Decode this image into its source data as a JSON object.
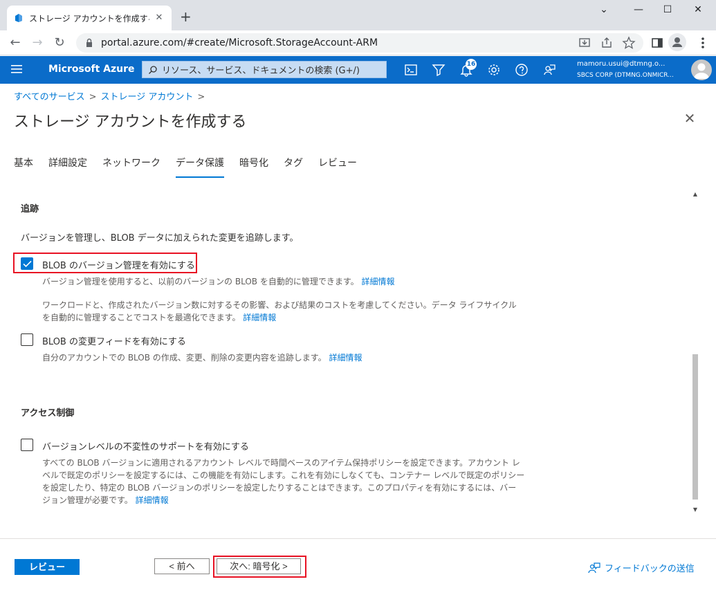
{
  "browser": {
    "tab_title": "ストレージ アカウントを作成する - Mic",
    "new_tab": "+",
    "url": "portal.azure.com/#create/Microsoft.StorageAccount-ARM",
    "min": "⌄",
    "minimize": "—",
    "maximize": "☐",
    "close": "✕"
  },
  "azure_bar": {
    "brand": "Microsoft Azure",
    "search_placeholder": "リソース、サービス、ドキュメントの検索 (G+/)",
    "notification_count": "16",
    "user_name": "mamoru.usui@dtmng.o...",
    "user_org": "SBCS CORP (DTMNG.ONMICR..."
  },
  "breadcrumb": {
    "item1": "すべてのサービス",
    "item2": "ストレージ アカウント",
    "sep": ">"
  },
  "page": {
    "title": "ストレージ アカウントを作成する",
    "more": "···",
    "close": "✕"
  },
  "tabs": [
    "基本",
    "詳細設定",
    "ネットワーク",
    "データ保護",
    "暗号化",
    "タグ",
    "レビュー"
  ],
  "tracking": {
    "title": "追跡",
    "desc": "バージョンを管理し、BLOB データに加えられた変更を追跡します。",
    "versioning_label": "BLOB のバージョン管理を有効にする",
    "versioning_desc": "バージョン管理を使用すると、以前のバージョンの BLOB を自動的に管理できます。",
    "versioning_link": "詳細情報",
    "workload_desc1": "ワークロードと、作成されたバージョン数に対するその影響、および結果のコストを考慮してください。データ ライフサイクル",
    "workload_desc2": "を自動的に管理することでコストを最適化できます。",
    "workload_link": "詳細情報",
    "changefeed_label": "BLOB の変更フィードを有効にする",
    "changefeed_desc": "自分のアカウントでの BLOB の作成、変更、削除の変更内容を追跡します。",
    "changefeed_link": "詳細情報"
  },
  "access": {
    "title": "アクセス制御",
    "immutability_label": "バージョンレベルの不変性のサポートを有効にする",
    "desc1": "すべての BLOB バージョンに適用されるアカウント レベルで時間ベースのアイテム保持ポリシーを設定できます。アカウント レ",
    "desc2": "ベルで既定のポリシーを設定するには、この機能を有効にします。これを有効にしなくても、コンテナー レベルで既定のポリシー",
    "desc3": "を設定したり、特定の BLOB バージョンのポリシーを設定したりすることはできます。このプロパティを有効にするには、バー",
    "desc4": "ジョン管理が必要です。",
    "link": "詳細情報"
  },
  "footer": {
    "review": "レビュー",
    "prev": "< 前へ",
    "next": "次へ: 暗号化 >",
    "feedback": "フィードバックの送信"
  },
  "colors": {
    "azure_blue": "#0b6cc9",
    "link": "#0078d4",
    "highlight": "#e81123"
  }
}
